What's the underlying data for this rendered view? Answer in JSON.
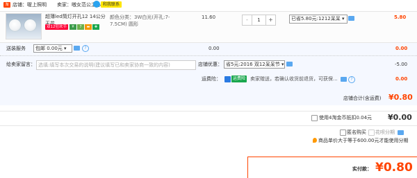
{
  "shop": {
    "icon_text": "淘",
    "shop_label": "店铺：",
    "shop_name": "喔上照明",
    "seller_label": "卖家：",
    "seller_name": "嗷女范公主心",
    "contact_label": "和我联系"
  },
  "item": {
    "title": "超薄led筒灯开孔12 14公分天花...",
    "badge": "双12狂欢节",
    "attr": "颜色分类：3W白光(开孔:7-7.5CM) 圆形",
    "price": "11.60",
    "quantity": "1",
    "minus": "-",
    "plus": "+",
    "promotion": "已省5.80元:1212呆呆",
    "total": "5.80"
  },
  "service": {
    "label": "送装服务",
    "option": "包邮 0.00元",
    "amount": "0.00",
    "total": "0.00"
  },
  "message": {
    "label": "给卖家留言：",
    "placeholder": "选填:填写本次交易的说明(建议填写已和卖家协商一致的内容)"
  },
  "coupon": {
    "label": "店铺优惠：",
    "option": "省5元:2016 双12呆呆节",
    "amount": "-5.00"
  },
  "insurance": {
    "label": "运费险：",
    "badge": "运费险",
    "text": "卖家赠送，若确认收货前退货，可获保...",
    "amount": "0.00"
  },
  "shop_total": {
    "label": "店铺合计(含运费)",
    "currency": "¥",
    "value": "0.80"
  },
  "coins": {
    "label": "使用4淘金币抵扣0.04元",
    "currency": "¥",
    "value": "0.00"
  },
  "options": {
    "anonymous": "匿名购买",
    "installment": "花呗分期",
    "note": "商品单价大于等于600.00元才能使用分期"
  },
  "payment": {
    "label": "实付款：",
    "currency": "¥",
    "value": "0.80"
  },
  "colors": {
    "accent": "#ff4400",
    "link": "#2a7ae2",
    "green": "#1aa74e"
  }
}
